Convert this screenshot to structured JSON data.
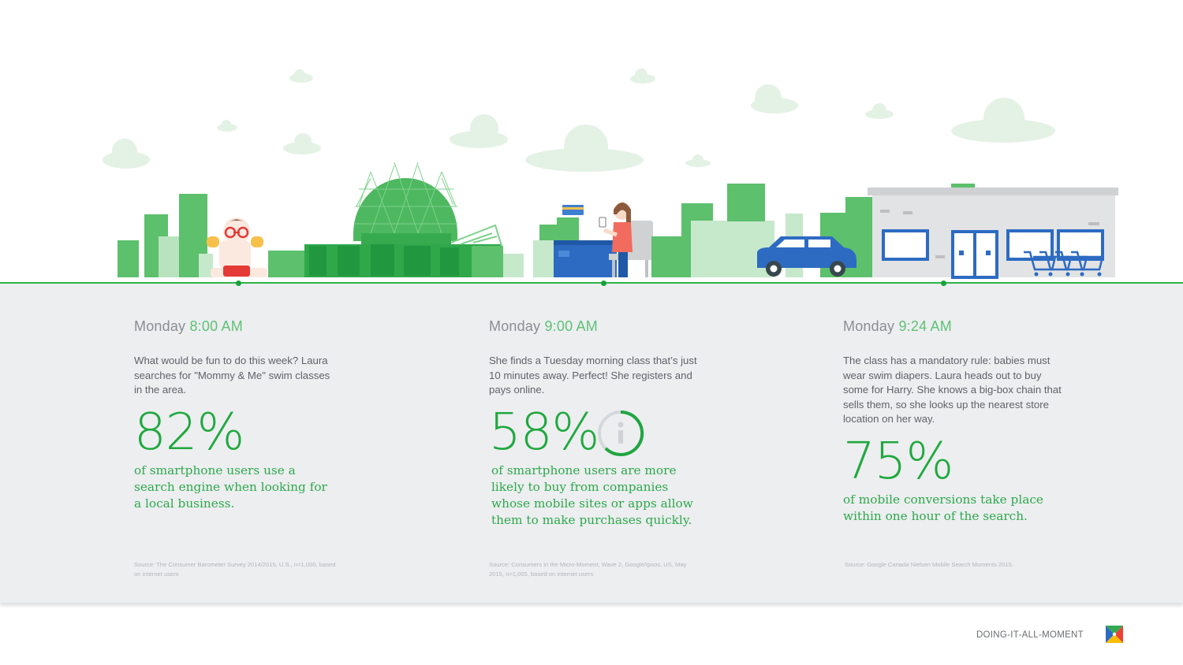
{
  "moments": [
    {
      "day": "Monday",
      "time": "8:00 AM",
      "description": "What would be fun to do this week? Laura searches for \"Mommy & Me\" swim classes in the area.",
      "stat": "82%",
      "stat_description": "of smartphone users use a search engine when looking for a local business.",
      "source": "Source: The Consumer Barometer Survey 2014/2015, U.S., n=1,000, based on internet users"
    },
    {
      "day": "Monday",
      "time": "9:00 AM",
      "description": "She finds a Tuesday morning class that’s just 10 minutes away. Perfect! She registers and pays online.",
      "stat": "58%",
      "stat_description": "of smartphone users are more likely to buy from companies whose mobile sites or apps allow them to make purchases quickly.",
      "source": "Source: Consumers in the Micro-Moment, Wave 2, Google/Ipsos, US, May 2015, n=1,005, based on internet users"
    },
    {
      "day": "Monday",
      "time": "9:24 AM",
      "description": "The class has a mandatory rule: babies must wear swim diapers. Laura heads out to buy some for Harry. She knows a big-box chain that sells them, so she looks up the nearest store location on her way.",
      "stat": "75%",
      "stat_description": "of mobile conversions take place within one hour of the search.",
      "source": "Source: Google Canada Nielsen Mobile Search Moments 2015."
    }
  ],
  "footer": {
    "label": "DOING-IT-ALL-MOMENT"
  },
  "icons": [
    "info-icon",
    "brand-logo-icon"
  ],
  "colors": {
    "accent_green": "#20a83e",
    "panel_bg": "#eceef0",
    "light_green": "#c8e8cc"
  }
}
